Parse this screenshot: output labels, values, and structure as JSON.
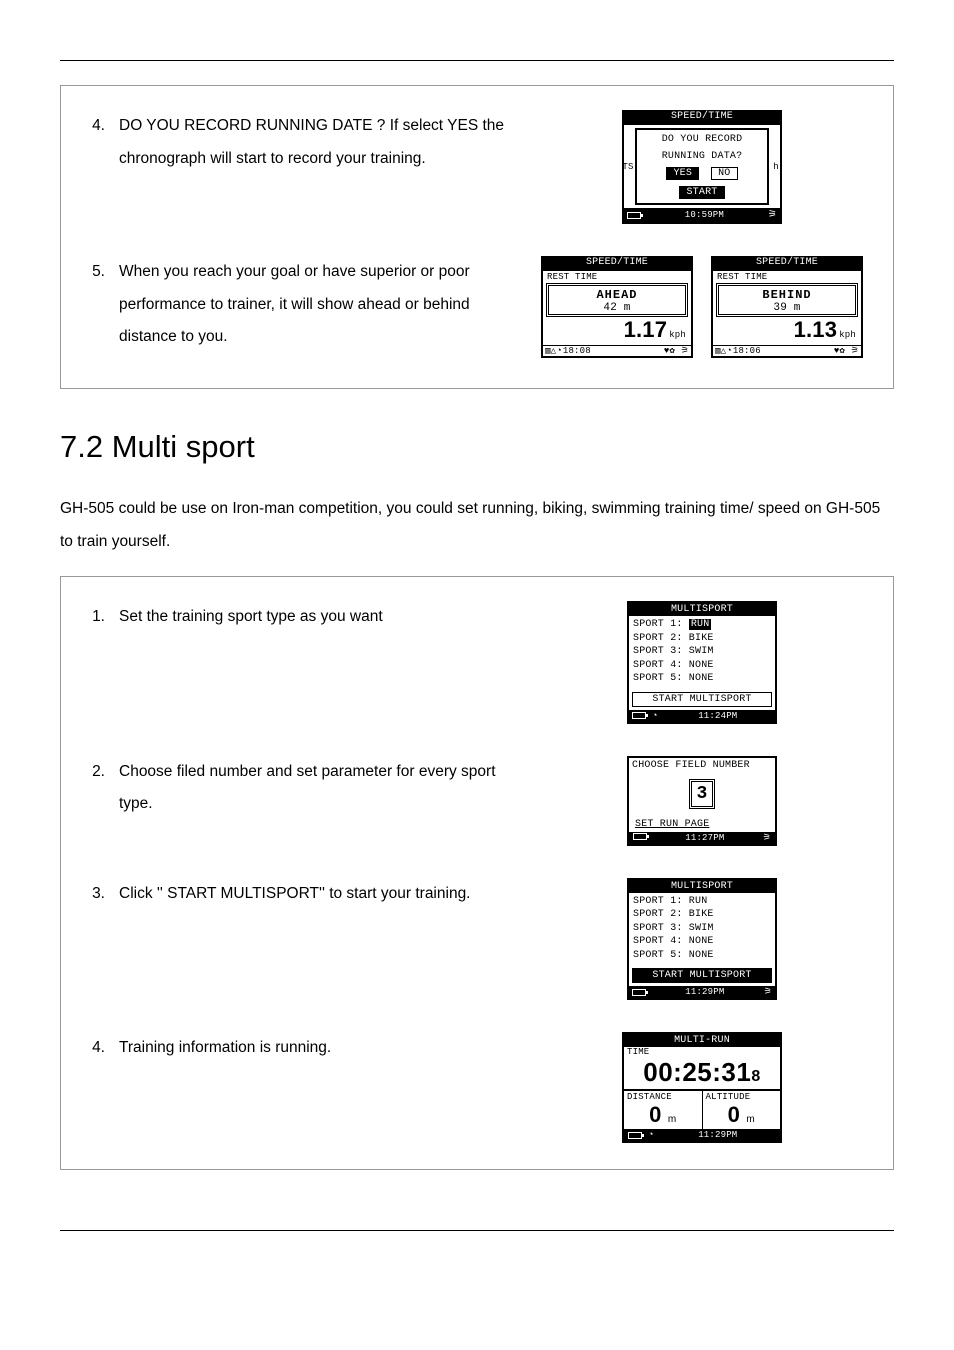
{
  "rule": true,
  "box1": {
    "step4": {
      "no": "4.",
      "text": "DO YOU RECORD RUNNING DATE ? If select YES the chronograph will start to record your training."
    },
    "step5": {
      "no": "5.",
      "text": "When you reach your goal or have superior or poor performance to trainer, it will show ahead or behind distance to you."
    }
  },
  "section_title": "7.2 Multi sport",
  "section_intro": "GH-505 could be use on Iron-man competition, you could set running, biking, swimming training time/ speed on GH-505 to train yourself.",
  "box2": {
    "s1": {
      "no": "1.",
      "text": "Set the training sport type as you want"
    },
    "s2": {
      "no": "2.",
      "text": "Choose filed number and set parameter for every sport type."
    },
    "s3": {
      "no": "3.",
      "text": "Click '' START MULTISPORT'' to start your training."
    },
    "s4": {
      "no": "4.",
      "text": "Training information is running."
    }
  },
  "scr_record": {
    "title": "SPEED/TIME",
    "prompt1": "DO YOU RECORD",
    "prompt2": "RUNNING DATA?",
    "left": "T",
    "right": "h",
    "left2": "S",
    "yes": "YES",
    "no": "NO",
    "start": "START",
    "foot_time": "10:59PM"
  },
  "scr_ahead": {
    "title": "SPEED/TIME",
    "rest": "REST TIME",
    "label": "AHEAD",
    "dist": "42 m",
    "val": "1.17",
    "unit": "kph",
    "foot": "18:08"
  },
  "scr_behind": {
    "title": "SPEED/TIME",
    "rest": "REST TIME",
    "label": "BEHIND",
    "dist": "39 m",
    "val": "1.13",
    "unit": "kph",
    "foot": "18:06"
  },
  "scr_ms1": {
    "title": "MULTISPORT",
    "rows": [
      "SPORT 1:",
      "SPORT 2: BIKE",
      "SPORT 3: SWIM",
      "SPORT 4: NONE",
      "SPORT 5: NONE"
    ],
    "sel": "RUN",
    "start": "START MULTISPORT",
    "foot": "11:24PM"
  },
  "scr_field": {
    "hdr": "CHOOSE FIELD NUMBER",
    "num": "3",
    "set": "SET RUN PAGE",
    "foot": "11:27PM"
  },
  "scr_ms2": {
    "title": "MULTISPORT",
    "rows": [
      "SPORT 1: RUN",
      "SPORT 2: BIKE",
      "SPORT 3: SWIM",
      "SPORT 4: NONE",
      "SPORT 5: NONE"
    ],
    "start": "START MULTISPORT",
    "foot": "11:29PM"
  },
  "scr_run": {
    "title": "MULTI-RUN",
    "time_label": "TIME",
    "time": "00:25:31",
    "time_ms": "8",
    "dist_label": "DISTANCE",
    "alt_label": "ALTITUDE",
    "dist_val": "0",
    "dist_unit": "m",
    "alt_val": "0",
    "alt_unit": "m",
    "foot": "11:29PM"
  },
  "chart_data": {
    "type": "table",
    "note": "Device screen readouts shown in the document",
    "screens": [
      {
        "name": "record_prompt",
        "title": "SPEED/TIME",
        "options": [
          "YES",
          "NO"
        ],
        "action": "START",
        "clock": "10:59PM"
      },
      {
        "name": "ahead",
        "title": "SPEED/TIME",
        "status": "AHEAD",
        "distance_m": 42,
        "speed_kph": 1.17,
        "elapsed": "18:08"
      },
      {
        "name": "behind",
        "title": "SPEED/TIME",
        "status": "BEHIND",
        "distance_m": 39,
        "speed_kph": 1.13,
        "elapsed": "18:06"
      },
      {
        "name": "multisport_setup",
        "title": "MULTISPORT",
        "sports": [
          "RUN",
          "BIKE",
          "SWIM",
          "NONE",
          "NONE"
        ],
        "selected_index": 0,
        "action": "START MULTISPORT",
        "clock": "11:24PM"
      },
      {
        "name": "choose_field",
        "field_number": 3,
        "action": "SET RUN PAGE",
        "clock": "11:27PM"
      },
      {
        "name": "multisport_start",
        "title": "MULTISPORT",
        "sports": [
          "RUN",
          "BIKE",
          "SWIM",
          "NONE",
          "NONE"
        ],
        "action": "START MULTISPORT",
        "clock": "11:29PM"
      },
      {
        "name": "multi_run",
        "title": "MULTI-RUN",
        "time": "00:25:31.8",
        "distance_m": 0,
        "altitude_m": 0,
        "clock": "11:29PM"
      }
    ]
  }
}
